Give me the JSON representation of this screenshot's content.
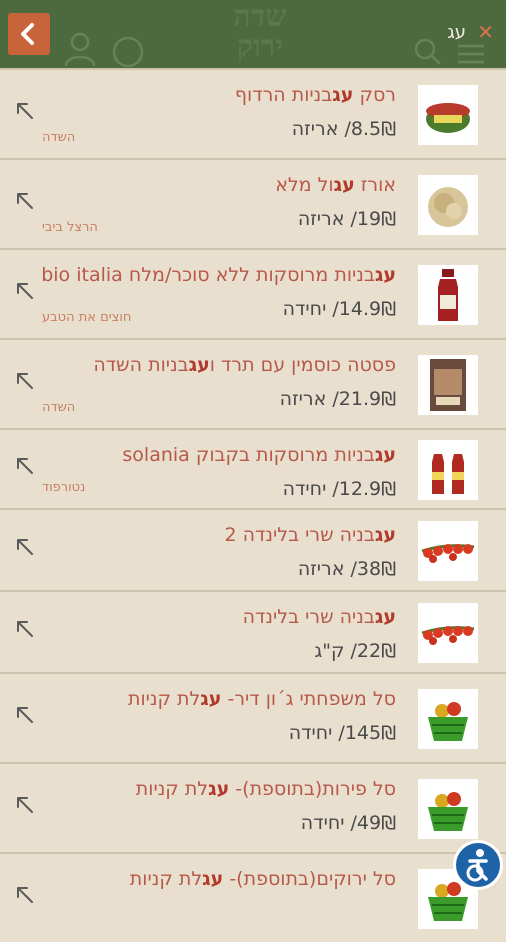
{
  "header": {
    "search_query": "עג",
    "logo_line1": "שדה",
    "logo_line2": "ירוק"
  },
  "products": [
    {
      "name_prefix": "רסק ",
      "name_highlight": "עג",
      "name_suffix": "בניות הרדוף",
      "price": "8.5₪/ אריזה",
      "vendor": "השדה",
      "thumb": "tomato-paste"
    },
    {
      "name_prefix": "אורז ",
      "name_highlight": "עג",
      "name_suffix": "ול מלא",
      "price": "19₪/ אריזה",
      "vendor": "הרצל ביבי",
      "thumb": "rice"
    },
    {
      "name_prefix": "",
      "name_highlight": "עג",
      "name_suffix": "בניות מרוסקות ללא סוכר/מלח bio italia",
      "price": "14.9₪/ יחידה",
      "vendor": "חוצים את הטבע",
      "thumb": "bottle"
    },
    {
      "name_prefix": "פסטה כוסמין עם תרד ו",
      "name_highlight": "עג",
      "name_suffix": "בניות השדה",
      "price": "21.9₪/ אריזה",
      "vendor": "השדה",
      "thumb": "pasta"
    },
    {
      "name_prefix": "",
      "name_highlight": "עג",
      "name_suffix": "בניות מרוסקות בקבוק solania",
      "price": "12.9₪/ יחידה",
      "vendor": "נטורפוד",
      "thumb": "two-bottles"
    },
    {
      "name_prefix": "",
      "name_highlight": "עג",
      "name_suffix": "בניה שרי בלינדה 2",
      "price": "38₪/ אריזה",
      "vendor": "",
      "thumb": "cherry-tomatoes"
    },
    {
      "name_prefix": "",
      "name_highlight": "עג",
      "name_suffix": "בניה שרי בלינדה",
      "price": "22₪/ ק\"ג",
      "vendor": "",
      "thumb": "cherry-tomatoes"
    },
    {
      "name_prefix": "סל משפחתי ג´ון דיר- ",
      "name_highlight": "עג",
      "name_suffix": "לת קניות",
      "price": "145₪/ יחידה",
      "vendor": "",
      "thumb": "basket"
    },
    {
      "name_prefix": "סל פירות(בתוספת)- ",
      "name_highlight": "עג",
      "name_suffix": "לת קניות",
      "price": "49₪/ יחידה",
      "vendor": "",
      "thumb": "basket"
    },
    {
      "name_prefix": "סל ירוקים(בתוספת)- ",
      "name_highlight": "עג",
      "name_suffix": "לת קניות",
      "price": "",
      "vendor": "",
      "thumb": "basket"
    }
  ],
  "icons": {
    "back": "chevron-left-icon",
    "clear": "close-icon",
    "row_arrow": "arrow-up-left-icon",
    "accessibility": "accessibility-icon"
  },
  "colors": {
    "header_bg": "#4d6a3e",
    "back_btn": "#c8643a",
    "row_bg": "#e9dfcf",
    "name_text": "#b7594a",
    "highlight": "#b13a2a",
    "vendor_text": "#c97f62"
  }
}
